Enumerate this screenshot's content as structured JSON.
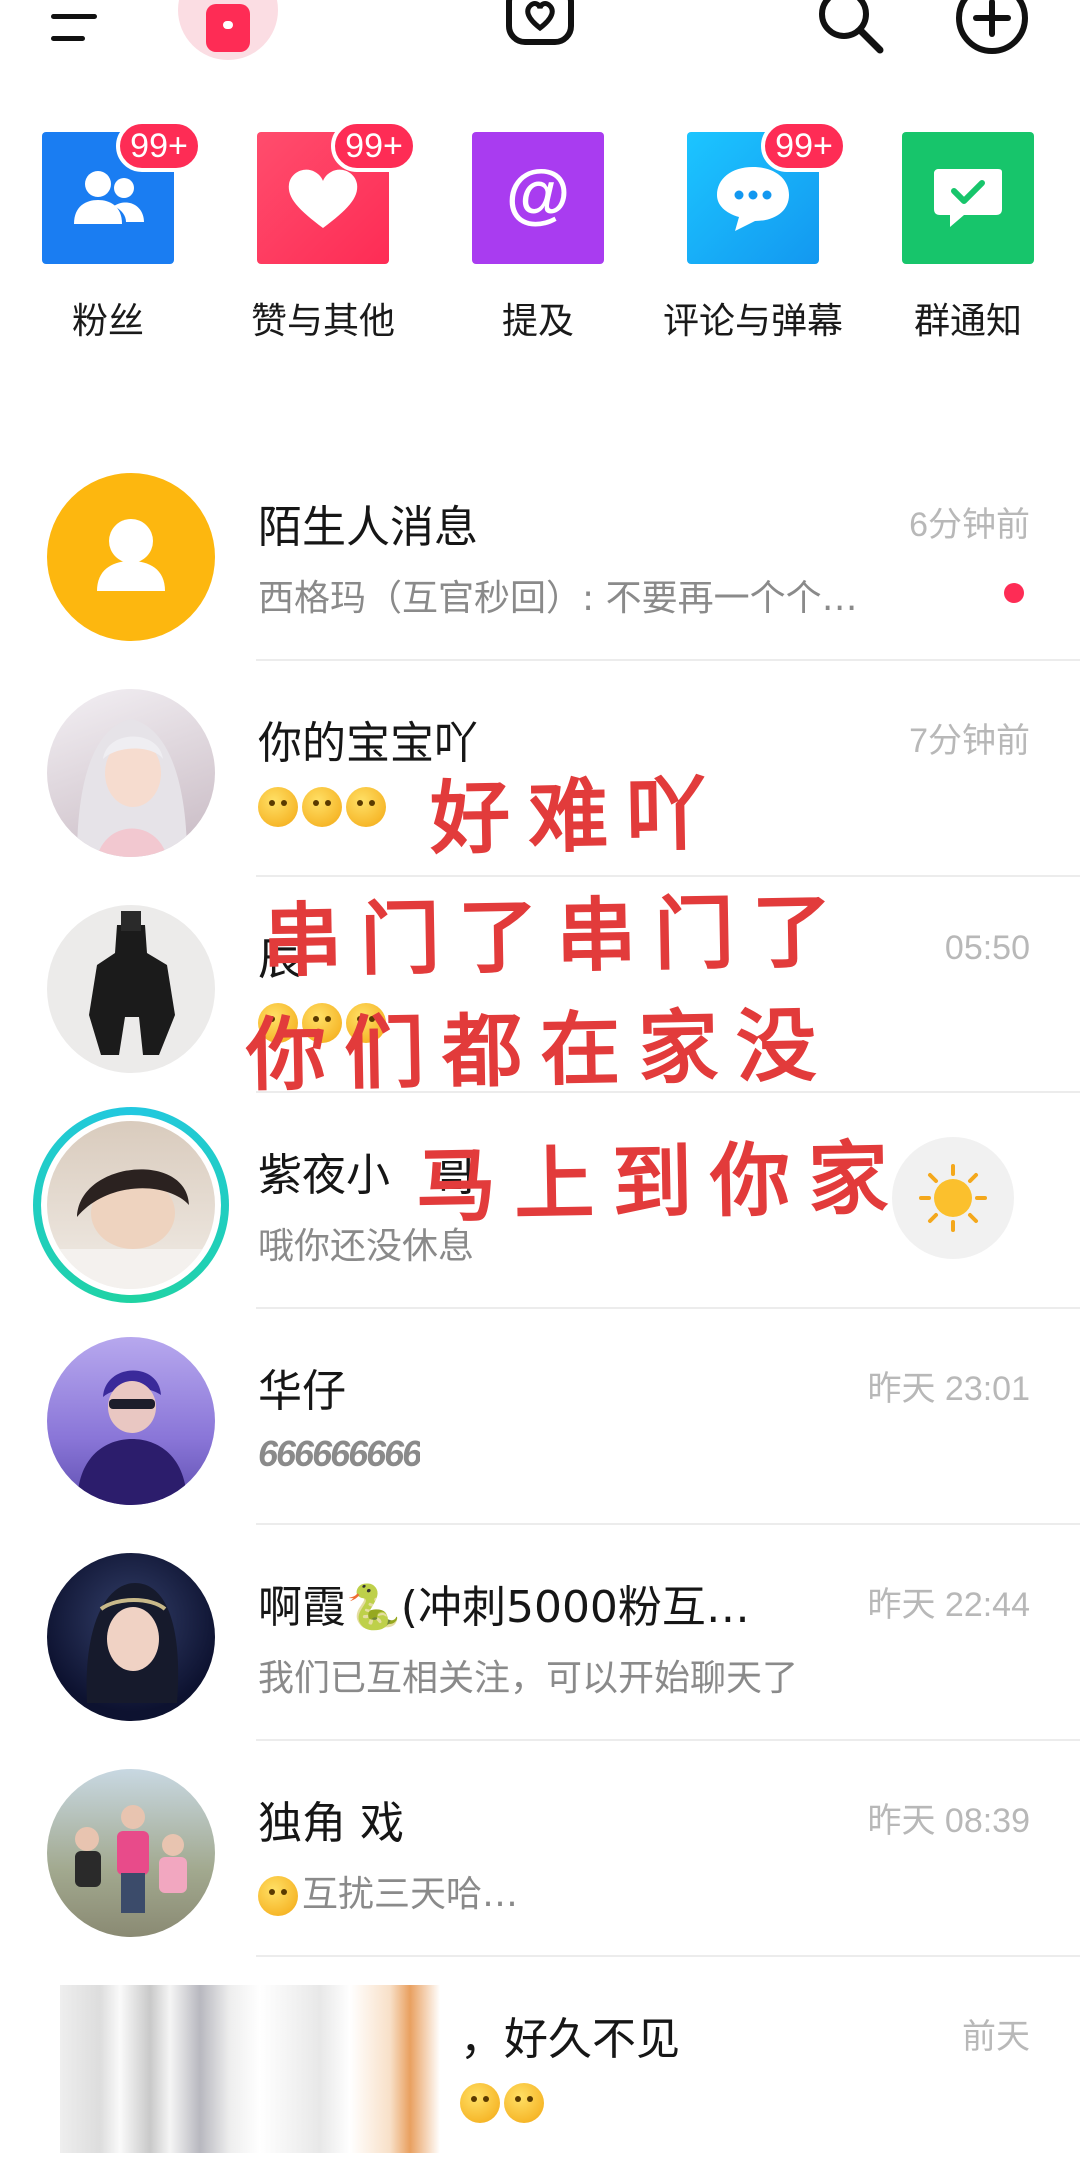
{
  "topbar": {
    "icons": [
      "menu-icon",
      "app-logo-icon",
      "camera-heart-icon",
      "search-icon",
      "add-icon"
    ]
  },
  "shortcuts": [
    {
      "label": "粉丝",
      "badge": "99+",
      "color": "#1a7df2",
      "icon": "fans-icon"
    },
    {
      "label": "赞与其他",
      "badge": "99+",
      "color": "#fe2c55",
      "icon": "heart-icon"
    },
    {
      "label": "提及",
      "badge": "",
      "color": "#a93cf0",
      "icon": "at-icon"
    },
    {
      "label": "评论与弹幕",
      "badge": "99+",
      "color": "#14aaf5",
      "icon": "comment-icon"
    },
    {
      "label": "群通知",
      "badge": "",
      "color": "#17c56b",
      "icon": "group-notice-icon"
    }
  ],
  "conversations": [
    {
      "name": "陌生人消息",
      "time": "6分钟前",
      "preview": "西格玛（互官秒回）: 不要再一个个…",
      "unread": true
    },
    {
      "name": "你的宝宝吖",
      "time": "7分钟前",
      "preview": ""
    },
    {
      "name": "辰",
      "time": "05:50",
      "preview": ""
    },
    {
      "name": "紫夜小",
      "name_tail": "哥",
      "time": "",
      "preview": "哦你还没休息"
    },
    {
      "name": "华仔",
      "time": "昨天 23:01",
      "preview": "666666666"
    },
    {
      "name": "啊霞🐍(冲刺5000粉互…",
      "time": "昨天 22:44",
      "preview": "我们已互相关注，可以开始聊天了"
    },
    {
      "name": "独角  戏",
      "time": "昨天 08:39",
      "preview": "互扰三天哈…"
    },
    {
      "name": "，好久不见",
      "time": "前天",
      "preview": ""
    }
  ],
  "handwriting": [
    "好难吖",
    "串门了串门了",
    "你们都在家没",
    "马上到你家"
  ],
  "colors": {
    "accent": "#fe2c55",
    "handwriting": "#e23b3b",
    "time_text": "#b8b8b8",
    "preview_text": "#8a8a8a"
  }
}
